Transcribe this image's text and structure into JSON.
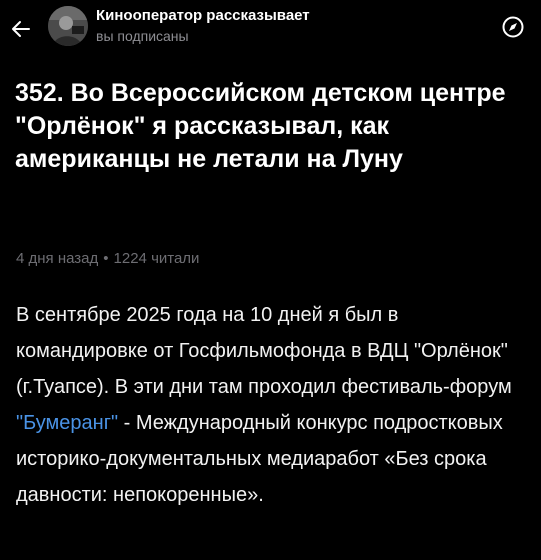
{
  "header": {
    "channel_name": "Кинооператор рассказывает",
    "subscription_status": "вы подписаны",
    "back_icon": "arrow-left-icon",
    "compass_icon": "compass-icon"
  },
  "article": {
    "title": "352. Во Всероссийском детском центре \"Орлёнок\" я рассказывал, как американцы не летали на Луну",
    "meta": {
      "time_ago": "4 дня назад",
      "separator": "•",
      "reads": "1224 читали"
    },
    "body": {
      "text_before_link": "В сентябре 2025 года на 10 дней я был в командировке от Госфильмофонда в ВДЦ \"Орлёнок\" (г.Туапсе). В эти дни там проходил фестиваль-форум ",
      "link_text": "\"Бумеранг\"",
      "text_after_link": " - Международный конкурс подростковых историко-документальных медиаработ «Без срока давности: непокоренные»."
    }
  },
  "colors": {
    "background": "#000000",
    "text": "#ffffff",
    "muted": "#8e8e93",
    "link": "#4a93e6"
  }
}
